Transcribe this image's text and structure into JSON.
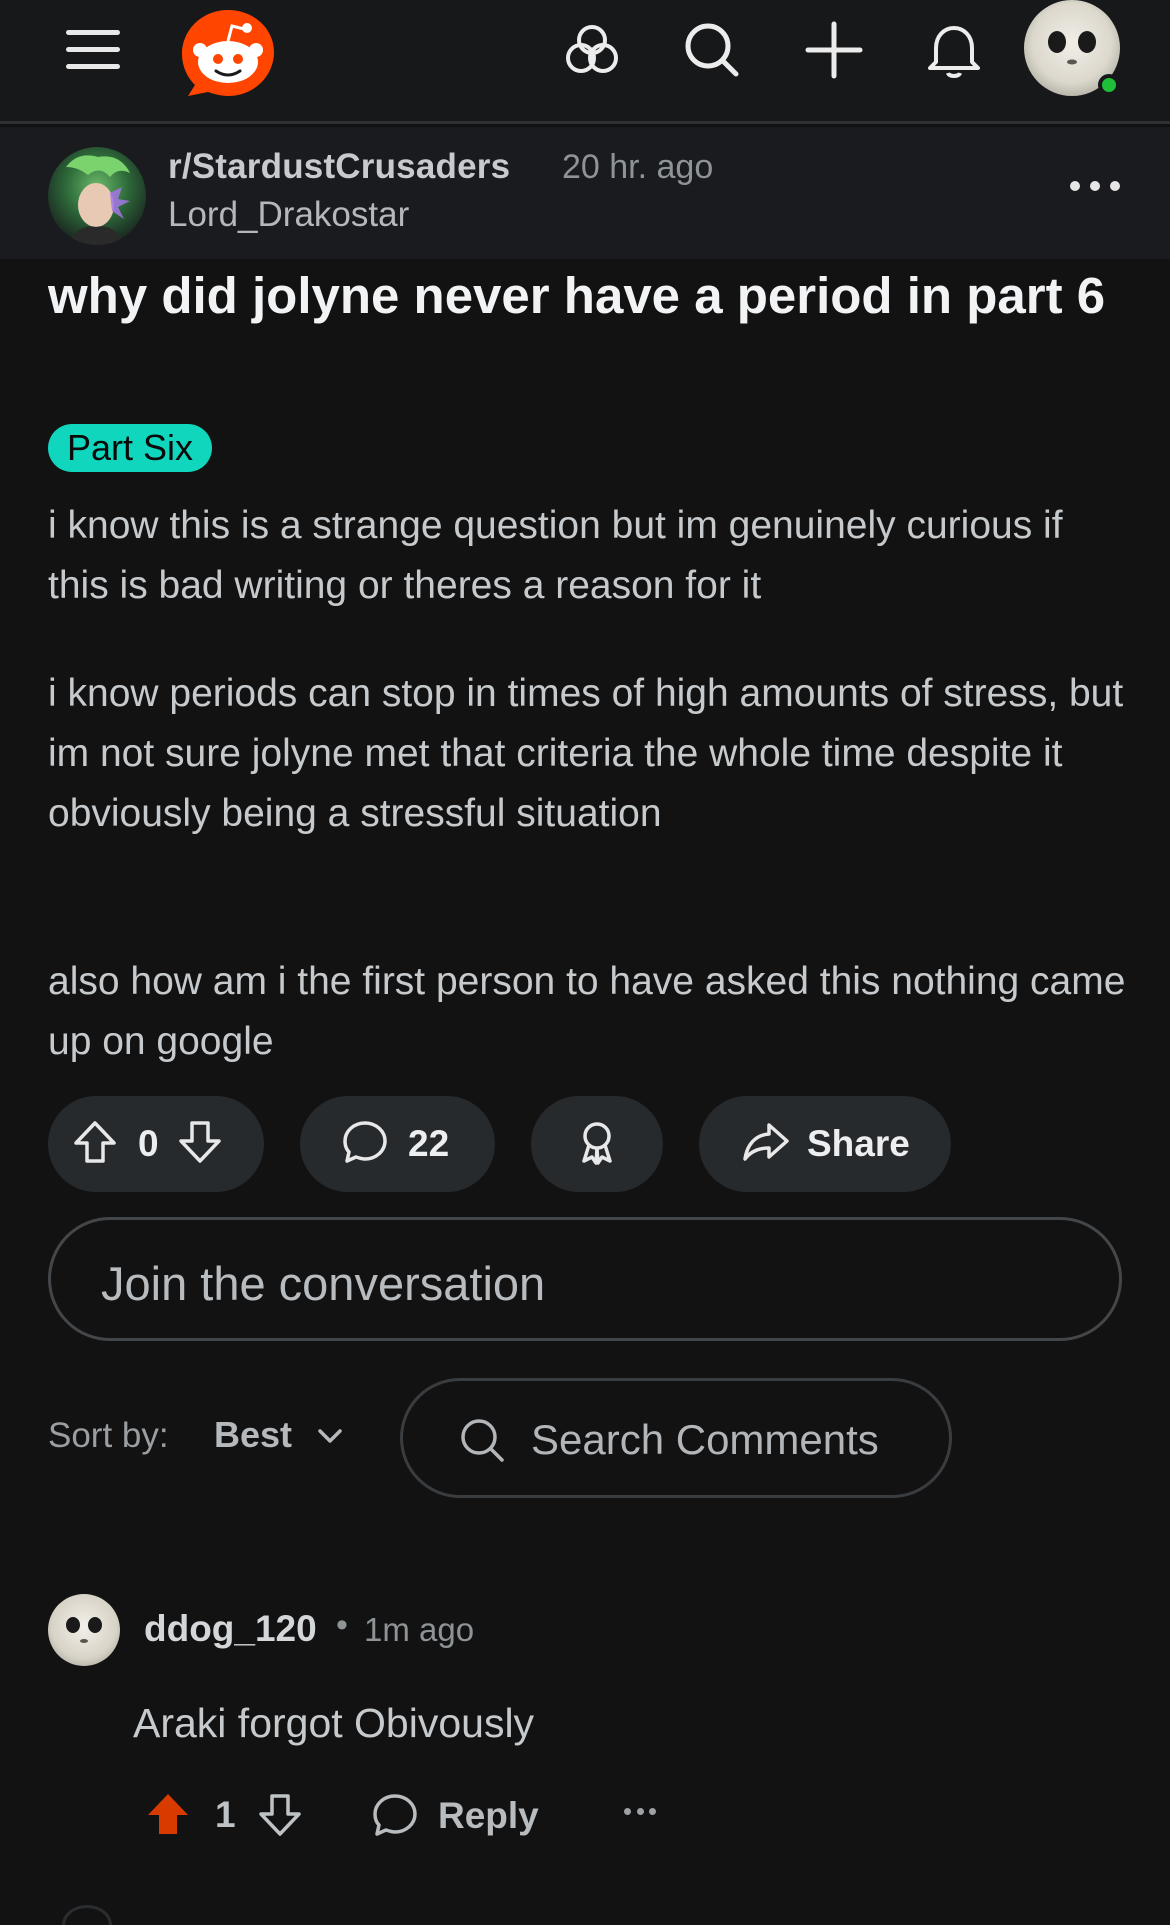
{
  "nav": {
    "icons": [
      "menu-icon",
      "reddit-logo",
      "communities-icon",
      "search-icon",
      "create-icon",
      "notifications-icon",
      "avatar"
    ],
    "online_status_color": "#1fbf3a"
  },
  "post": {
    "subreddit": "r/StardustCrusaders",
    "time": "20 hr. ago",
    "author": "Lord_Drakostar",
    "title": "why did jolyne never have a period in part 6",
    "flair": "Part Six",
    "flair_color": "#0fd6bc",
    "paragraphs": [
      "i know this is a strange question but im genuinely curious if this is bad writing or theres a reason for it",
      "i know periods can stop in times of high amounts of stress, but im not sure jolyne met that criteria the whole time despite it obviously being a stressful situation",
      "also how am i the first person to have asked this nothing came up on google"
    ],
    "vote_count": "0",
    "comment_count": "22",
    "share_label": "Share"
  },
  "join": {
    "placeholder": "Join the conversation"
  },
  "sort": {
    "label": "Sort by:",
    "value": "Best"
  },
  "search_comments": {
    "placeholder": "Search Comments"
  },
  "comments": [
    {
      "user": "ddog_120",
      "separator": "•",
      "time": "1m ago",
      "text": "Araki forgot Obivously",
      "votes": "1",
      "upvoted": true,
      "upvote_color": "#d93a00",
      "reply_label": "Reply"
    }
  ]
}
